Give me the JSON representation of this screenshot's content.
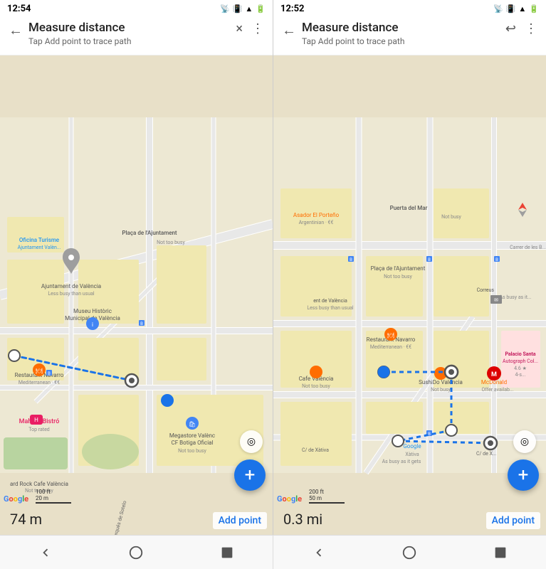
{
  "panels": [
    {
      "id": "left",
      "status": {
        "time": "12:54",
        "icons": [
          "cast",
          "vibrate",
          "wifi",
          "battery"
        ]
      },
      "header": {
        "back_icon": "←",
        "title": "Measure distance",
        "subtitle": "Tap Add point to trace path",
        "close_icon": "×",
        "menu_icon": "⋮"
      },
      "distance": "74 m",
      "add_point_label": "Add point",
      "fab_label": "+"
    },
    {
      "id": "right",
      "status": {
        "time": "12:52",
        "icons": [
          "cast",
          "vibrate",
          "wifi",
          "battery"
        ]
      },
      "header": {
        "back_icon": "←",
        "title": "Measure distance",
        "subtitle": "Tap Add point to trace path",
        "undo_icon": "↩",
        "menu_icon": "⋮"
      },
      "distance": "0.3 mi",
      "add_point_label": "Add point",
      "fab_label": "+"
    }
  ],
  "bottom_nav": {
    "back_icon": "◀",
    "home_icon": "○",
    "recent_icon": "■"
  }
}
